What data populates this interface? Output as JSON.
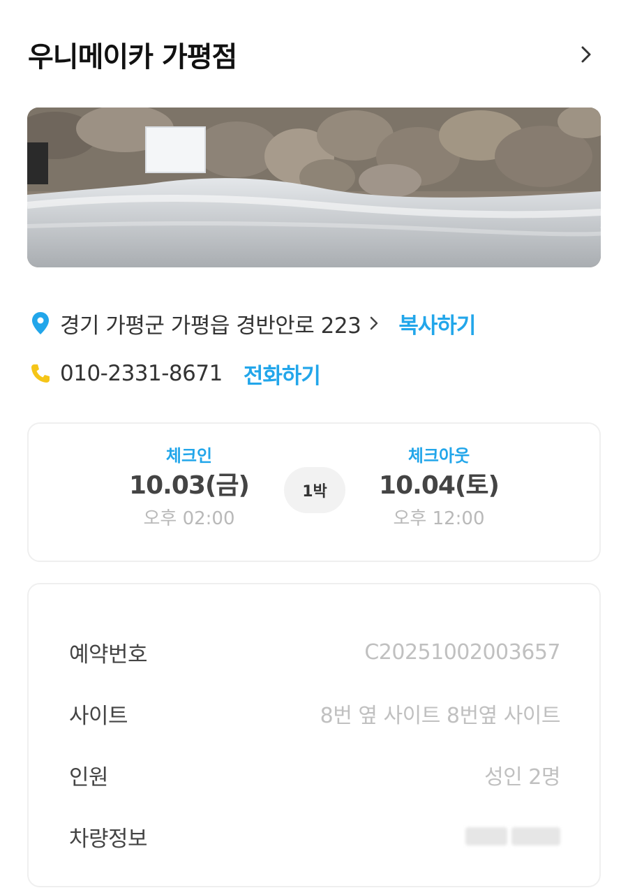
{
  "header": {
    "title": "우니메이카 가평점",
    "chevron_icon": "chevron-right-icon"
  },
  "hero": {
    "icon": "campsite-photo"
  },
  "address": {
    "icon": "location-pin-icon",
    "text": "경기 가평군 가평읍 경반안로 223",
    "copy_label": "복사하기",
    "accent": "#22a6ea"
  },
  "phone": {
    "icon": "phone-icon",
    "number": "010-2331-8671",
    "call_label": "전화하기",
    "icon_color": "#f5c518"
  },
  "checkin": {
    "in_label": "체크인",
    "in_date": "10.03(금)",
    "in_time": "오후 02:00",
    "nights": "1박",
    "out_label": "체크아웃",
    "out_date": "10.04(토)",
    "out_time": "오후 12:00"
  },
  "details": {
    "rows": [
      {
        "label": "예약번호",
        "value": "C20251002003657"
      },
      {
        "label": "사이트",
        "value": "8번 옆 사이트 8번옆 사이트"
      },
      {
        "label": "인원",
        "value": "성인 2명"
      },
      {
        "label": "차량정보",
        "value": ""
      }
    ]
  }
}
